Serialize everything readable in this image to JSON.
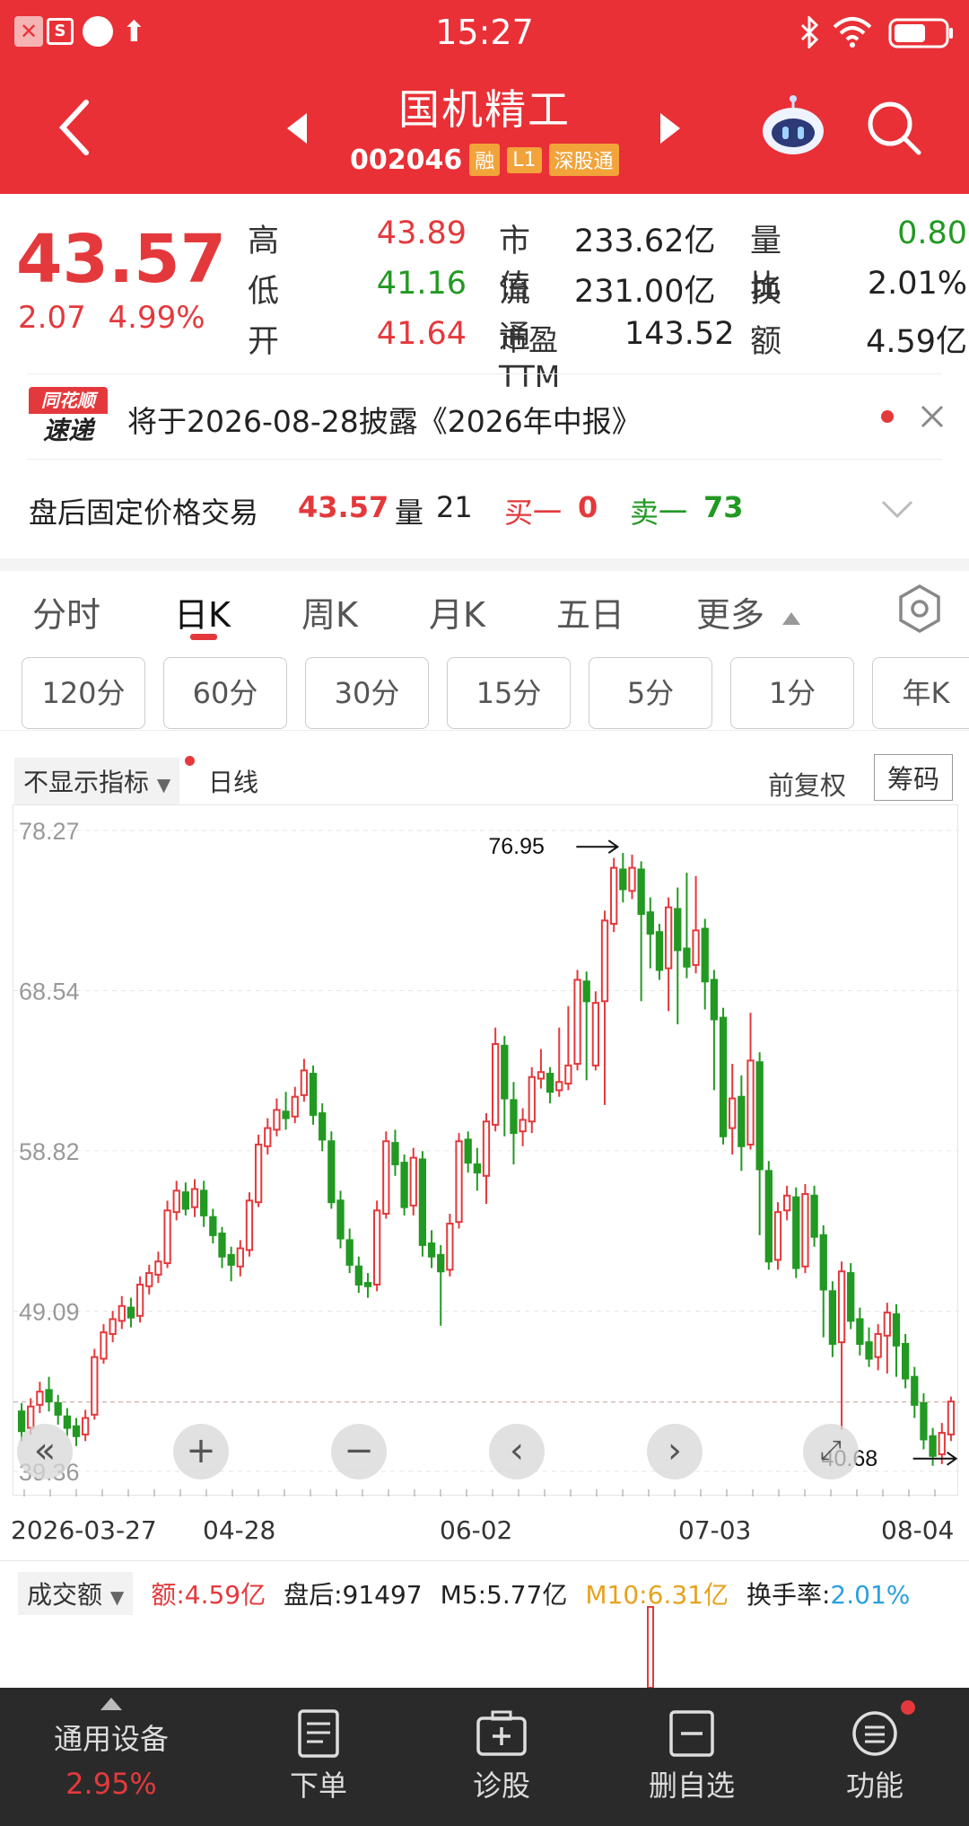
{
  "status_bar": {
    "time": "15:27"
  },
  "nav": {
    "title": "国机精工",
    "code": "002046",
    "tags": [
      "融",
      "L1",
      "深股通"
    ]
  },
  "quote": {
    "price": "43.57",
    "change": "2.07",
    "change_pct": "4.99%",
    "stats": [
      {
        "label": "高",
        "value": "43.89"
      },
      {
        "label": "低",
        "value": "41.16"
      },
      {
        "label": "开",
        "value": "41.64"
      },
      {
        "label": "市值",
        "value": "233.62亿"
      },
      {
        "label": "流通",
        "value": "231.00亿"
      },
      {
        "label": "市盈TTM",
        "value": "143.52"
      },
      {
        "label": "量比",
        "value": "0.80"
      },
      {
        "label": "换",
        "value": "2.01%"
      },
      {
        "label": "额",
        "value": "4.59亿"
      }
    ],
    "colors": {
      "up": "#e4393c",
      "down": "#229922"
    }
  },
  "notice": {
    "badge_top": "同花顺",
    "badge_bottom": "速递",
    "text": "将于2026-08-28披露《2026年中报》"
  },
  "after_hours": {
    "label": "盘后固定价格交易",
    "price": "43.57",
    "vol_label": "量",
    "vol": "21",
    "buy_label": "买一",
    "buy": "0",
    "sell_label": "卖一",
    "sell": "73"
  },
  "tabs": [
    "分时",
    "日K",
    "周K",
    "月K",
    "五日",
    "更多"
  ],
  "active_tab": "日K",
  "interval_chips": [
    "120分",
    "60分",
    "30分",
    "15分",
    "5分",
    "1分",
    "年K"
  ],
  "kline_toolbar": {
    "indicator": "不显示指标",
    "line_type": "日线",
    "adjust": "前复权",
    "chips_btn": "筹码"
  },
  "chart_data": {
    "type": "candlestick",
    "y_ticks": [
      "78.27",
      "68.54",
      "58.82",
      "49.09",
      "39.36"
    ],
    "ylim": [
      39.36,
      78.27
    ],
    "x_ticks": [
      "2026-03-27",
      "04-28",
      "06-02",
      "07-03",
      "08-04"
    ],
    "max_label": "76.95",
    "min_label": "40.68",
    "last_close": 43.57,
    "grid": true,
    "candles": [
      [
        43.0,
        41.8,
        43.5,
        41.2
      ],
      [
        42.0,
        43.3,
        43.8,
        41.6
      ],
      [
        43.4,
        44.2,
        44.8,
        42.9
      ],
      [
        44.3,
        43.6,
        45.1,
        43.0
      ],
      [
        43.5,
        42.8,
        44.0,
        42.2
      ],
      [
        42.7,
        42.0,
        43.2,
        41.5
      ],
      [
        42.1,
        41.5,
        42.6,
        40.9
      ],
      [
        41.6,
        42.6,
        43.1,
        41.2
      ],
      [
        42.8,
        46.3,
        46.8,
        42.5
      ],
      [
        46.2,
        47.8,
        48.3,
        45.9
      ],
      [
        47.7,
        48.6,
        49.1,
        47.2
      ],
      [
        48.5,
        49.4,
        50.0,
        48.0
      ],
      [
        49.3,
        48.7,
        49.9,
        48.1
      ],
      [
        48.8,
        50.7,
        51.2,
        48.4
      ],
      [
        50.6,
        51.4,
        51.9,
        50.1
      ],
      [
        51.3,
        52.1,
        52.7,
        50.8
      ],
      [
        52.0,
        55.2,
        55.8,
        51.7
      ],
      [
        55.1,
        56.4,
        57.0,
        54.6
      ],
      [
        56.3,
        55.3,
        56.9,
        54.9
      ],
      [
        55.4,
        56.5,
        57.1,
        54.8
      ],
      [
        56.4,
        54.9,
        57.0,
        54.2
      ],
      [
        54.8,
        53.7,
        55.3,
        53.2
      ],
      [
        53.8,
        52.4,
        54.2,
        51.7
      ],
      [
        52.5,
        51.9,
        53.0,
        50.9
      ],
      [
        51.8,
        52.9,
        53.4,
        51.2
      ],
      [
        52.8,
        55.8,
        56.3,
        52.4
      ],
      [
        55.7,
        59.2,
        59.8,
        55.4
      ],
      [
        59.1,
        60.2,
        60.8,
        58.6
      ],
      [
        60.1,
        61.3,
        62.0,
        59.7
      ],
      [
        61.2,
        60.8,
        62.4,
        60.1
      ],
      [
        60.9,
        62.1,
        62.7,
        60.5
      ],
      [
        62.2,
        63.7,
        64.4,
        61.8
      ],
      [
        63.5,
        61.0,
        64.0,
        60.4
      ],
      [
        61.1,
        59.5,
        61.7,
        58.8
      ],
      [
        59.4,
        55.7,
        60.0,
        55.3
      ],
      [
        55.8,
        53.5,
        56.4,
        52.9
      ],
      [
        53.4,
        51.9,
        54.1,
        51.4
      ],
      [
        51.8,
        50.7,
        52.4,
        50.2
      ],
      [
        50.8,
        50.6,
        51.4,
        49.9
      ],
      [
        50.7,
        55.2,
        55.8,
        50.3
      ],
      [
        55.0,
        59.4,
        60.0,
        54.7
      ],
      [
        59.3,
        58.0,
        60.1,
        57.3
      ],
      [
        58.1,
        55.4,
        58.6,
        54.9
      ],
      [
        55.5,
        58.4,
        59.0,
        54.9
      ],
      [
        58.3,
        53.1,
        58.8,
        52.4
      ],
      [
        53.2,
        52.4,
        54.0,
        51.7
      ],
      [
        52.5,
        51.5,
        53.1,
        48.2
      ],
      [
        51.6,
        54.4,
        55.0,
        51.2
      ],
      [
        54.5,
        59.4,
        59.9,
        54.1
      ],
      [
        59.5,
        58.1,
        60.0,
        57.5
      ],
      [
        58.0,
        57.5,
        59.0,
        56.4
      ],
      [
        57.3,
        60.6,
        61.1,
        55.6
      ],
      [
        60.4,
        65.3,
        66.3,
        60.0
      ],
      [
        65.2,
        62.0,
        65.8,
        59.7
      ],
      [
        61.9,
        59.9,
        63.0,
        58.0
      ],
      [
        60.0,
        60.7,
        61.4,
        59.1
      ],
      [
        60.6,
        63.3,
        63.9,
        59.9
      ],
      [
        63.2,
        63.6,
        65.0,
        62.6
      ],
      [
        63.5,
        62.4,
        63.9,
        61.7
      ],
      [
        62.5,
        63.0,
        66.3,
        62.1
      ],
      [
        62.9,
        64.0,
        67.6,
        62.5
      ],
      [
        64.1,
        69.2,
        69.8,
        63.7
      ],
      [
        69.1,
        67.9,
        69.7,
        63.1
      ],
      [
        64.0,
        67.8,
        68.5,
        63.7
      ],
      [
        67.9,
        72.8,
        73.4,
        61.6
      ],
      [
        72.6,
        76.0,
        76.6,
        72.1
      ],
      [
        75.9,
        74.7,
        76.9,
        73.9
      ],
      [
        74.6,
        76.0,
        76.8,
        74.1
      ],
      [
        75.9,
        73.2,
        76.4,
        67.9
      ],
      [
        73.3,
        72.0,
        74.2,
        69.9
      ],
      [
        72.1,
        69.8,
        72.6,
        69.2
      ],
      [
        69.9,
        73.6,
        74.2,
        67.3
      ],
      [
        73.5,
        71.0,
        74.8,
        66.5
      ],
      [
        71.1,
        70.0,
        75.7,
        69.3
      ],
      [
        70.1,
        72.2,
        75.5,
        69.6
      ],
      [
        72.3,
        69.1,
        72.9,
        67.4
      ],
      [
        69.2,
        66.8,
        69.8,
        62.5
      ],
      [
        66.9,
        59.7,
        67.5,
        59.2
      ],
      [
        60.2,
        62.0,
        64.1,
        58.6
      ],
      [
        62.1,
        59.1,
        63.4,
        57.6
      ],
      [
        59.2,
        64.3,
        67.2,
        58.9
      ],
      [
        64.2,
        57.7,
        64.8,
        53.7
      ],
      [
        57.6,
        52.1,
        58.2,
        51.6
      ],
      [
        52.2,
        55.1,
        55.7,
        51.6
      ],
      [
        55.2,
        56.1,
        56.7,
        54.6
      ],
      [
        56.0,
        51.7,
        56.6,
        51.1
      ],
      [
        51.8,
        56.2,
        56.8,
        51.4
      ],
      [
        56.1,
        53.6,
        56.7,
        53.0
      ],
      [
        53.7,
        50.4,
        54.3,
        47.5
      ],
      [
        50.3,
        47.1,
        50.9,
        46.3
      ],
      [
        47.2,
        51.5,
        52.1,
        41.9
      ],
      [
        51.4,
        48.5,
        52.0,
        48.0
      ],
      [
        48.6,
        47.1,
        49.3,
        46.4
      ],
      [
        47.2,
        46.2,
        48.1,
        45.7
      ],
      [
        46.3,
        47.7,
        48.3,
        45.5
      ],
      [
        47.6,
        49.0,
        49.6,
        45.3
      ],
      [
        48.9,
        47.0,
        49.5,
        45.1
      ],
      [
        47.1,
        45.0,
        47.7,
        44.4
      ],
      [
        45.1,
        43.4,
        45.7,
        42.6
      ],
      [
        43.5,
        41.3,
        44.1,
        40.7
      ],
      [
        41.5,
        40.3,
        42.0,
        39.7
      ],
      [
        40.4,
        41.7,
        42.3,
        39.8
      ],
      [
        41.6,
        43.6,
        43.9,
        41.2
      ]
    ]
  },
  "volume": {
    "selector": "成交额",
    "amount_label": "额:",
    "amount": "4.59亿",
    "after_label": "盘后:",
    "after": "91497",
    "m5_label": "M5:",
    "m5": "5.77亿",
    "m10_label": "M10:",
    "m10": "6.31亿",
    "turnover_label": "换手率:",
    "turnover": "2.01%"
  },
  "bottom_bar": {
    "sector": "通用设备",
    "sector_pct": "2.95%",
    "items": [
      "下单",
      "诊股",
      "删自选",
      "功能"
    ]
  }
}
